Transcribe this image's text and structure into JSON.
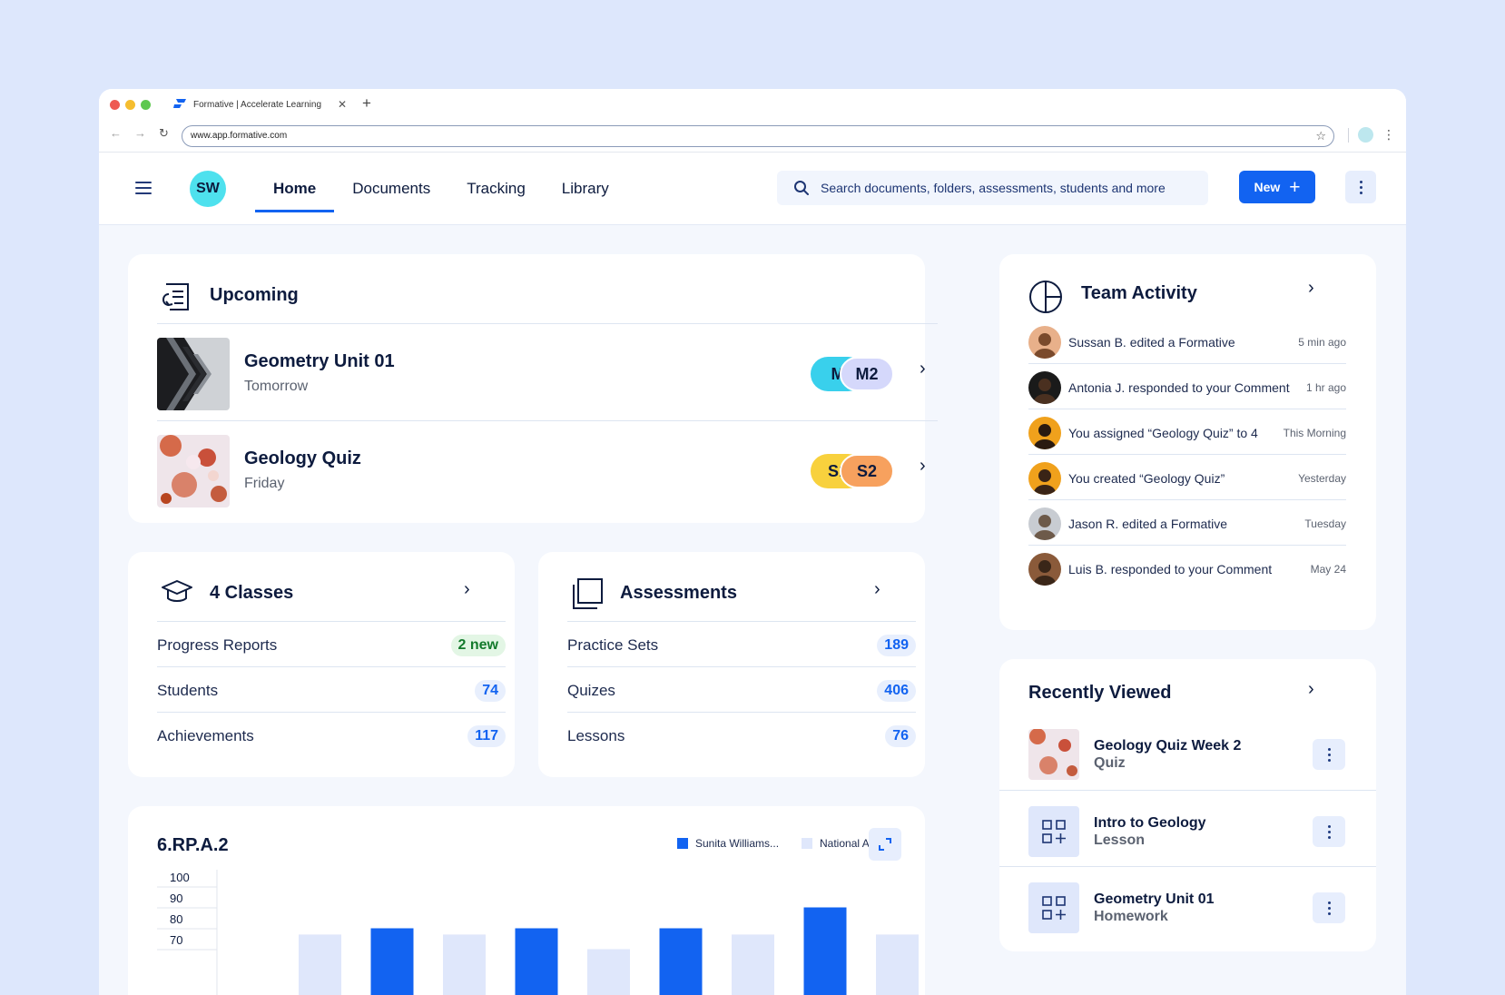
{
  "browser": {
    "tab_title": "Formative | Accelerate Learning",
    "url": "www.app.formative.com"
  },
  "nav": {
    "avatar_initials": "SW",
    "items": [
      "Home",
      "Documents",
      "Tracking",
      "Library"
    ],
    "active": "Home",
    "search_placeholder": "Search documents, folders, assessments, students and more",
    "new_label": "New"
  },
  "upcoming": {
    "title": "Upcoming",
    "items": [
      {
        "title": "Geometry Unit 01",
        "when": "Tomorrow",
        "pill_back": "M",
        "pill_front": "M2"
      },
      {
        "title": "Geology Quiz",
        "when": "Friday",
        "pill_back": "S1",
        "pill_front": "S2"
      }
    ]
  },
  "classes": {
    "title": "4 Classes",
    "rows": [
      {
        "label": "Progress Reports",
        "value": "2 new"
      },
      {
        "label": "Students",
        "value": "74"
      },
      {
        "label": "Achievements",
        "value": "117"
      }
    ]
  },
  "assessments": {
    "title": "Assessments",
    "rows": [
      {
        "label": "Practice Sets",
        "value": "189"
      },
      {
        "label": "Quizes",
        "value": "406"
      },
      {
        "label": "Lessons",
        "value": "76"
      }
    ]
  },
  "team_activity": {
    "title": "Team Activity",
    "items": [
      {
        "text": "Sussan B. edited a Formative",
        "time": "5 min ago"
      },
      {
        "text": "Antonia J. responded to your Comment",
        "time": "1 hr ago"
      },
      {
        "text": "You assigned “Geology Quiz” to 4",
        "time": "This Morning"
      },
      {
        "text": "You created “Geology Quiz”",
        "time": "Yesterday"
      },
      {
        "text": "Jason R. edited a Formative",
        "time": "Tuesday"
      },
      {
        "text": "Luis B. responded to your Comment",
        "time": "May 24"
      }
    ]
  },
  "recently_viewed": {
    "title": "Recently Viewed",
    "items": [
      {
        "name": "Geology Quiz Week 2",
        "type": "Quiz"
      },
      {
        "name": "Intro to Geology",
        "type": "Lesson"
      },
      {
        "name": "Geometry Unit 01",
        "type": "Homework"
      }
    ]
  },
  "chart_card": {
    "title": "6.RP.A.2",
    "colors": {
      "primary": "#1263f1",
      "secondary": "#dfe7fb"
    }
  },
  "chart_data": {
    "type": "bar",
    "title": "6.RP.A.2",
    "series": [
      {
        "name": "Sunita Williams...",
        "values": [
          null,
          75,
          null,
          75,
          null,
          75,
          null,
          85,
          null
        ]
      },
      {
        "name": "National Avg.",
        "values": [
          72,
          null,
          72,
          null,
          65,
          null,
          72,
          null,
          72
        ]
      }
    ],
    "y_ticks": [
      100,
      90,
      80,
      70
    ],
    "ylim": [
      65,
      100
    ]
  }
}
